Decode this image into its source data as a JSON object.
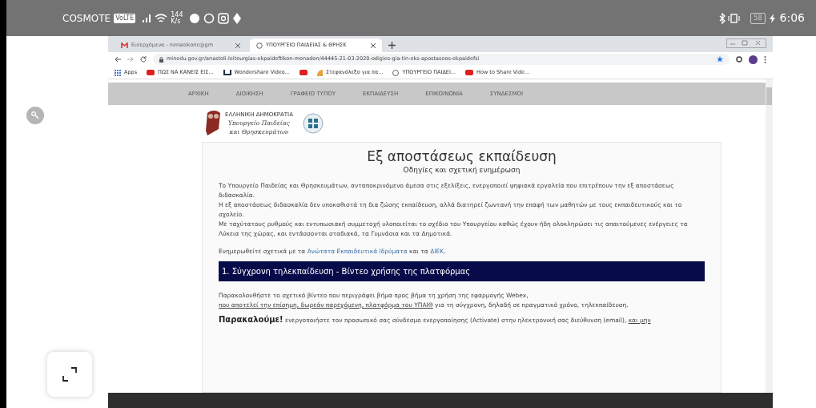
{
  "status_bar": {
    "carrier": "COSMOTE",
    "network_badge": "VoLTE",
    "speed_value": "144",
    "speed_unit": "K/s",
    "battery": "58",
    "time": "6:06"
  },
  "browser": {
    "tabs": [
      {
        "title": "Εισερχόμενα - nenaoikonc@gm",
        "selected": false
      },
      {
        "title": "ΥΠΟΥΡΓΕΙΟ ΠΑΙΔΕΙΑΣ & ΘΡΗΣΚ",
        "selected": true
      }
    ],
    "url": "minedu.gov.gr/anastoli-leitourgias-ekpaideftikon-monadon/44445-21-03-2020-odigies-gia-tin-eks-apostaseos-ekpaidefsi",
    "bookmarks": [
      {
        "label": "Apps",
        "kind": "apps"
      },
      {
        "label": "ΠΩΣ ΝΑ ΚΑΝΕΙΣ ΕΙΣ...",
        "kind": "video"
      },
      {
        "label": "Wondershare Video...",
        "kind": "wondershare"
      },
      {
        "kind": "video"
      },
      {
        "label": "Στεφανόλεξο για πα...",
        "kind": "page"
      },
      {
        "label": "ΥΠΟΥΡΓΕΙΟ ΠΑΙΔΕΙ...",
        "kind": "globe"
      },
      {
        "label": "How to Share Vide...",
        "kind": "video"
      }
    ]
  },
  "page": {
    "nav": [
      "ΑΡΧΙΚΗ",
      "ΔΙΟΙΚΗΣΗ",
      "ΓΡΑΦΕΙΟ ΤΥΠΟΥ",
      "ΕΚΠΑΙΔΕΥΣΗ",
      "ΕΠΙΚΟΙΝΩΝΙΑ",
      "ΣΥΝΔΕΣΜΟΙ"
    ],
    "logo_lines": [
      "ΕΛΛΗΝΙΚΗ ΔΗΜΟΚΡΑΤΙΑ",
      "Υπουργείο Παιδείας",
      "και Θρησκευμάτων"
    ],
    "title": "Εξ αποστάσεως εκπαίδευση",
    "subtitle": "Οδηγίες και σχετική ενημέρωση",
    "intro": [
      "Το Υπουργείο Παιδείας και Θρησκευμάτων, ανταποκρινόμενο άμεσα στις εξελίξεις, ενεργοποιεί ψηφιακά εργαλεία που επιτρέπουν την εξ αποστάσεως διδασκαλία.",
      "Η εξ αποστάσεως διδασκαλία δεν υποκαθιστά τη δια ζώσης εκπαίδευση, αλλά διατηρεί ζωντανή την επαφή των μαθητών με τους εκπαιδευτικούς και το σχολείο.",
      "Με ταχύτατους ρυθμούς και εντυπωσιακή συμμετοχή υλοποιείται το σχέδιο του Υπουργείου καθώς έχουν ήδη ολοκληρώσει τις απαιτούμενες ενέργειες τα Λύκεια της χώρας, και εντάσσονται σταδιακά, τα Γυμνάσια και τα Δημοτικά."
    ],
    "update": [
      {
        "kind": "text",
        "text": "Ενημερωθείτε σχετικά με τα"
      },
      {
        "kind": "link",
        "text": "Ανώτατα Εκπαιδευτικά Ιδρύματα"
      },
      {
        "kind": "text",
        "text": "και τα"
      },
      {
        "kind": "link",
        "text": "ΔΙΕΚ"
      },
      {
        "kind": "text",
        "text": "."
      }
    ],
    "section_heading": "1. Σύγχρονη τηλεκπαίδευση - Βίντεο χρήσης της πλατφόρμας",
    "section_text": [
      {
        "kind": "text",
        "text": "Παρακολουθήστε το σχετικό βίντεο που περιγράφει βήμα προς βήμα τη χρήση της εφαρμογής Webex,"
      },
      {
        "kind": "underline",
        "text": "που αποτελεί την επίσημη, δωρεάν παρεχόμενη, πλατφόρμα του ΥΠΑΙΘ"
      },
      {
        "kind": "text",
        "text": "για τη σύγχρονη, δηλαδή σε πραγματικό χρόνο, τηλεκπαίδευση."
      }
    ],
    "notice": [
      {
        "kind": "bold",
        "text": "Παρακαλούμε!"
      },
      {
        "kind": "text",
        "text": "ενεργοποιήστε τον προσωπικό σας σύνδεσμο ενεργοποίησης (Activate) στην ηλεκτρονική σας διεύθυνση (email),"
      },
      {
        "kind": "underline",
        "text": "και μην"
      }
    ]
  }
}
